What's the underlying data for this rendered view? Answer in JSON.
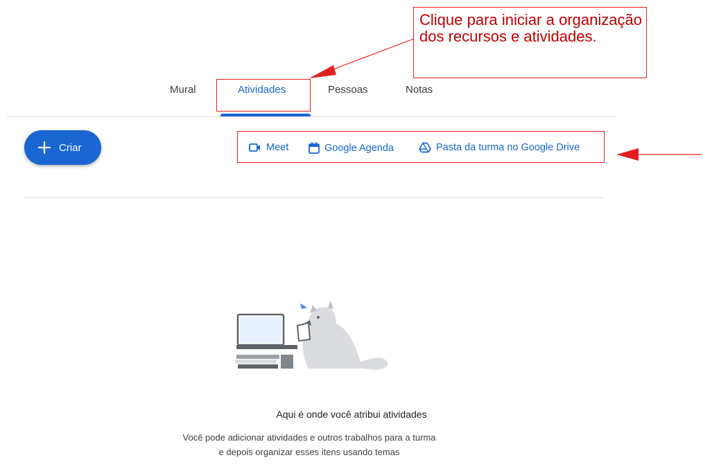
{
  "tabs": [
    {
      "label": "Mural"
    },
    {
      "label": "Atividades"
    },
    {
      "label": "Pessoas"
    },
    {
      "label": "Notas"
    }
  ],
  "create_button": {
    "label": "Criar"
  },
  "links": [
    {
      "label": "Meet",
      "icon": "video-camera-icon"
    },
    {
      "label": "Google Agenda",
      "icon": "calendar-icon"
    },
    {
      "label": "Pasta da turma no Google Drive",
      "icon": "drive-icon"
    }
  ],
  "annotation": {
    "text": "Clique para iniciar a organização dos recursos e atividades."
  },
  "empty_state": {
    "title": "Aqui é onde você atribui atividades",
    "description": "Você pode adicionar atividades e outros trabalhos para a turma e depois organizar esses itens usando temas"
  },
  "colors": {
    "accent": "#1967d2",
    "annotation": "#e02020"
  }
}
